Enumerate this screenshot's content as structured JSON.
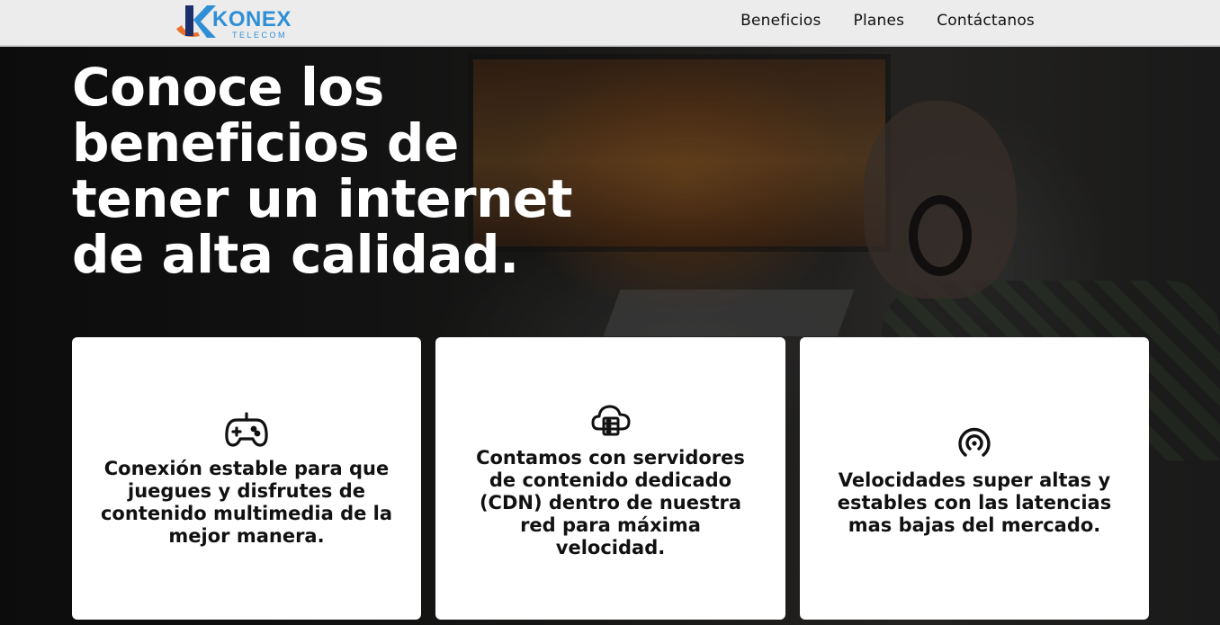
{
  "header": {
    "logo": {
      "brand": "KONEX",
      "subtitle": "TELECOM",
      "colors": {
        "blue": "#2f8fd6",
        "orange": "#e8702a",
        "navy": "#1b2f6b"
      }
    },
    "nav": [
      {
        "label": "Beneficios"
      },
      {
        "label": "Planes"
      },
      {
        "label": "Contáctanos"
      }
    ]
  },
  "hero": {
    "headline": "Conoce los beneficios de tener un internet de alta calidad."
  },
  "cards": [
    {
      "icon": "gamepad-icon",
      "text": "Conexión estable para que juegues y disfrutes de contenido multimedia de la mejor manera."
    },
    {
      "icon": "cloud-server-icon",
      "text": "Contamos con servidores de contenido dedicado (CDN) dentro de nuestra red para máxima velocidad."
    },
    {
      "icon": "broadcast-signal-icon",
      "text": "Velocidades super altas y estables con las latencias mas bajas del mercado."
    }
  ]
}
